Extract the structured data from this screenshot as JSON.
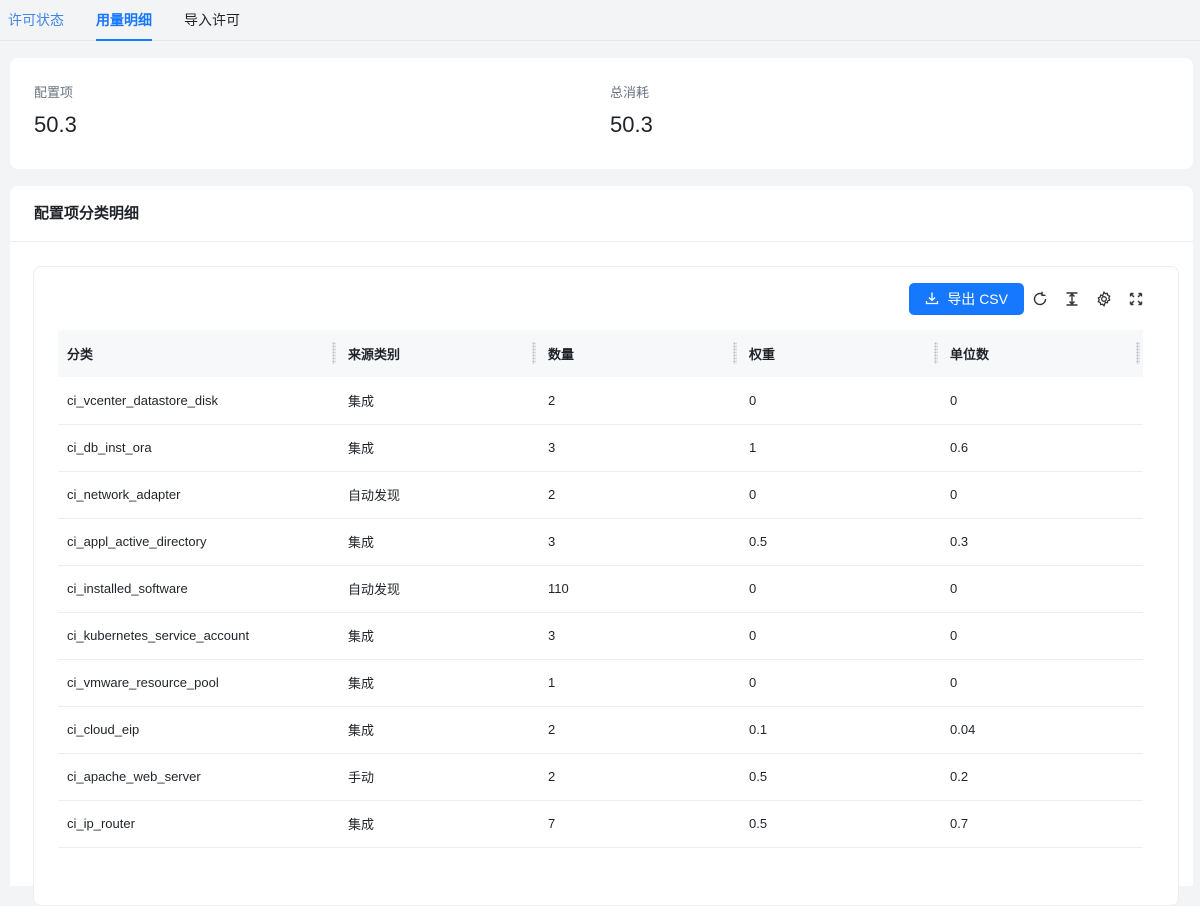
{
  "tabs": [
    {
      "label": "许可状态"
    },
    {
      "label": "用量明细"
    },
    {
      "label": "导入许可"
    }
  ],
  "summary": {
    "config_items": {
      "label": "配置项",
      "value": "50.3"
    },
    "total_consumption": {
      "label": "总消耗",
      "value": "50.3"
    }
  },
  "detail": {
    "title": "配置项分类明细",
    "export_label": "导出 CSV",
    "columns": [
      "分类",
      "来源类别",
      "数量",
      "权重",
      "单位数"
    ],
    "rows": [
      [
        "ci_vcenter_datastore_disk",
        "集成",
        "2",
        "0",
        "0"
      ],
      [
        "ci_db_inst_ora",
        "集成",
        "3",
        "1",
        "0.6"
      ],
      [
        "ci_network_adapter",
        "自动发现",
        "2",
        "0",
        "0"
      ],
      [
        "ci_appl_active_directory",
        "集成",
        "3",
        "0.5",
        "0.3"
      ],
      [
        "ci_installed_software",
        "自动发现",
        "110",
        "0",
        "0"
      ],
      [
        "ci_kubernetes_service_account",
        "集成",
        "3",
        "0",
        "0"
      ],
      [
        "ci_vmware_resource_pool",
        "集成",
        "1",
        "0",
        "0"
      ],
      [
        "ci_cloud_eip",
        "集成",
        "2",
        "0.1",
        "0.04"
      ],
      [
        "ci_apache_web_server",
        "手动",
        "2",
        "0.5",
        "0.2"
      ],
      [
        "ci_ip_router",
        "集成",
        "7",
        "0.5",
        "0.7"
      ]
    ]
  },
  "icons": [
    "download-icon",
    "refresh-icon",
    "density-icon",
    "settings-icon",
    "fullscreen-icon"
  ],
  "colors": {
    "accent": "#1677ff"
  }
}
